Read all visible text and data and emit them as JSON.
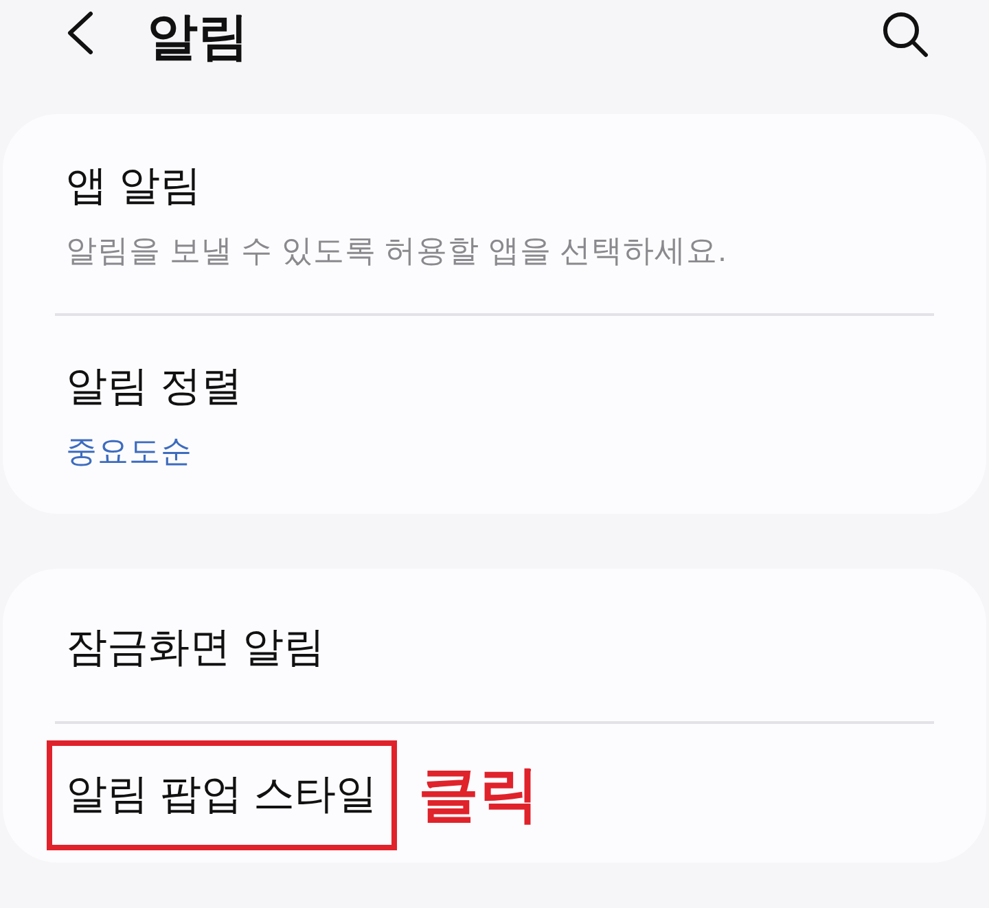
{
  "header": {
    "title": "알림"
  },
  "cards": [
    {
      "items": [
        {
          "title": "앱 알림",
          "subtitle": "알림을 보낼 수 있도록 허용할 앱을 선택하세요.",
          "highlighted": false
        },
        {
          "title": "알림 정렬",
          "value": "중요도순",
          "highlighted": false
        }
      ]
    },
    {
      "items": [
        {
          "title": "잠금화면 알림",
          "highlighted": false
        },
        {
          "title": "알림 팝업 스타일",
          "highlighted": true,
          "callout": "클릭"
        }
      ]
    }
  ]
}
